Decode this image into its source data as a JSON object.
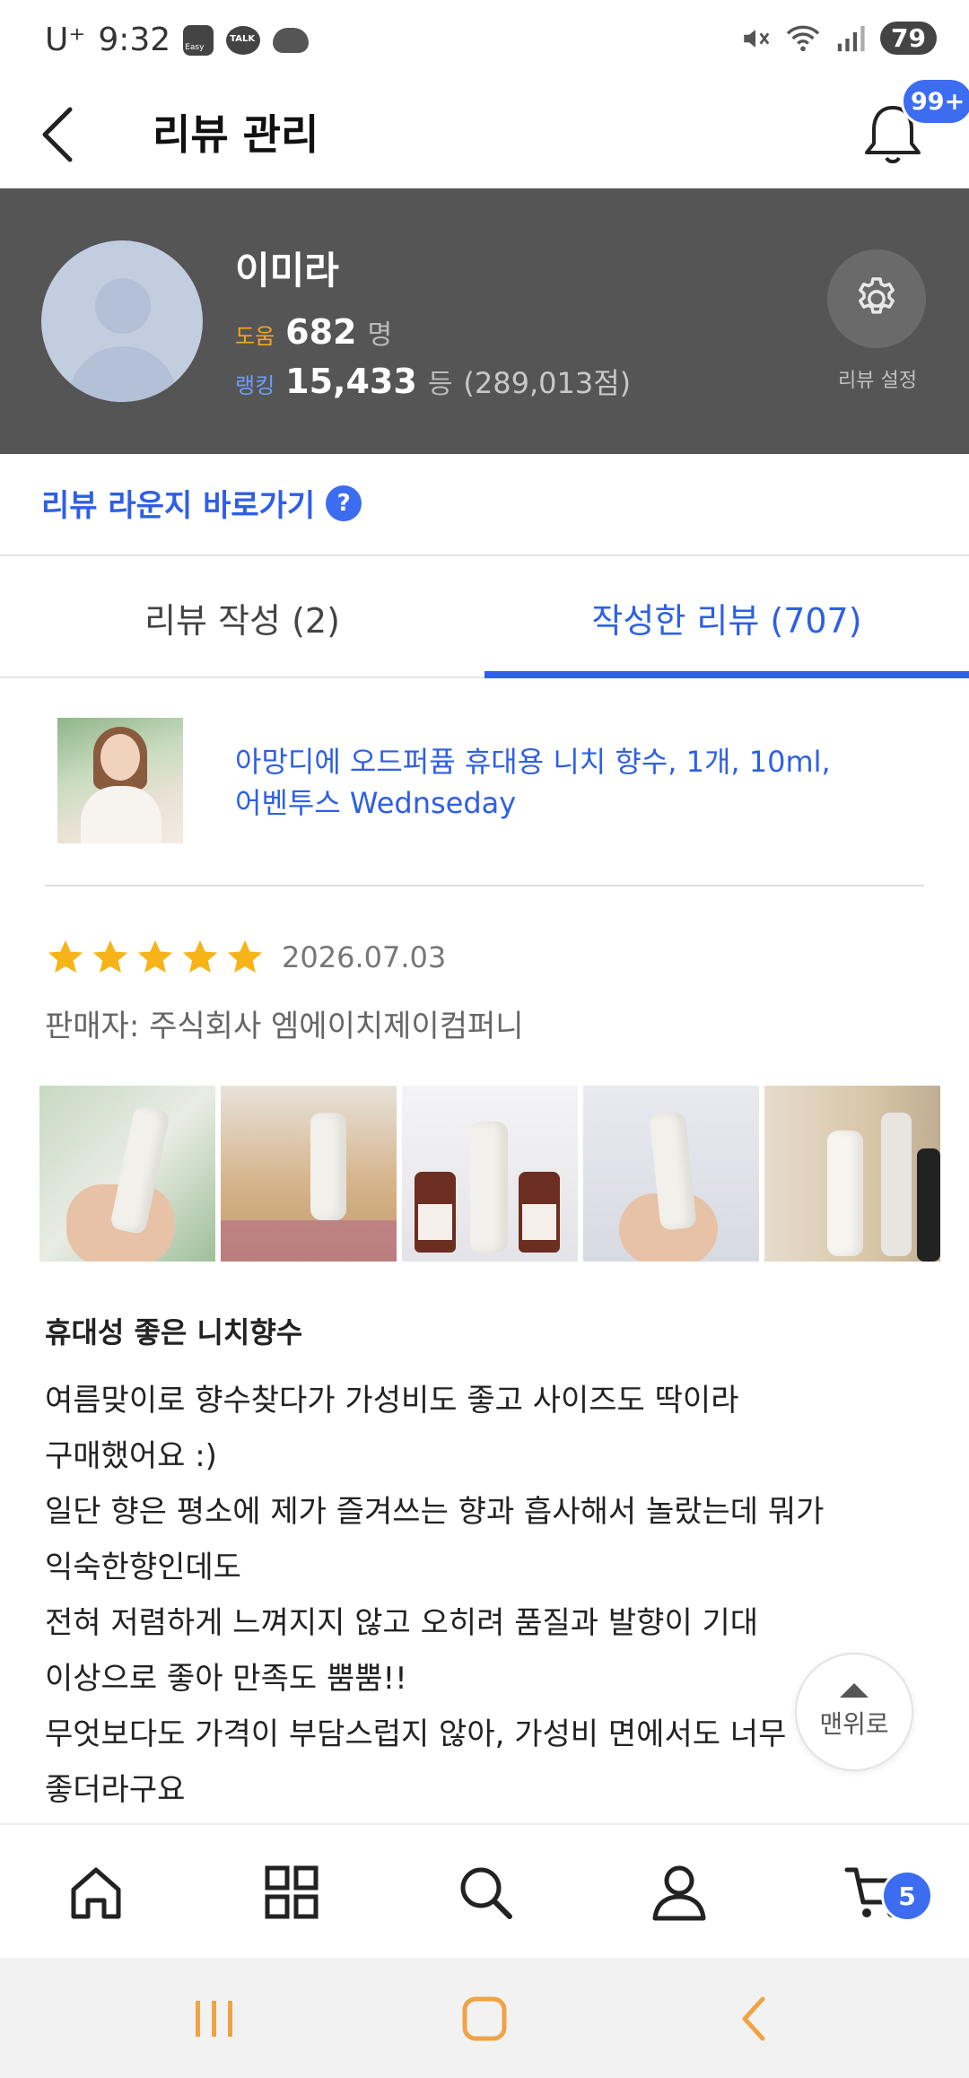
{
  "status_bar": {
    "carrier": "U⁺",
    "time": "9:32",
    "icon_easy": "Easy",
    "icon_talk": "TALK",
    "battery": "79"
  },
  "header": {
    "title": "리뷰 관리",
    "notification_count": "99+"
  },
  "profile": {
    "name": "이미라",
    "help_label": "도움",
    "help_value": "682",
    "help_unit": "명",
    "rank_label": "랭킹",
    "rank_value": "15,433",
    "rank_unit": "등",
    "rank_points": "(289,013점)",
    "settings_label": "리뷰 설정"
  },
  "lounge": {
    "label": "리뷰 라운지 바로가기",
    "help_symbol": "?"
  },
  "tabs": [
    {
      "label": "리뷰 작성 (2)",
      "active": false
    },
    {
      "label": "작성한 리뷰 (707)",
      "active": true
    }
  ],
  "product": {
    "name_line1": "아망디에 오드퍼퓸 휴대용 니치 향수, 1개, 10ml,",
    "name_line2": "어벤투스 Wednseday"
  },
  "review": {
    "rating": 5,
    "date": "2026.07.03",
    "seller": "판매자: 주식회사 엠에이치제이컴퍼니",
    "photo_count": 5,
    "title": "휴대성 좋은 니치향수",
    "body_lines": [
      "여름맞이로 향수찾다가 가성비도 좋고 사이즈도 딱이라",
      "구매했어요 :)",
      "일단 향은 평소에 제가 즐겨쓰는 향과 흡사해서 놀랐는데 뭐가",
      "익숙한향인데도",
      "전혀 저렴하게 느껴지지 않고 오히려 품질과 발향이 기대",
      "이상으로 좋아 만족도 뿜뿜!!",
      "무엇보다도 가격이 부담스럽지 않아, 가성비 면에서도 너무",
      "좋더라구요"
    ]
  },
  "scroll_top": {
    "label": "맨위로"
  },
  "bottom_nav": {
    "items": [
      "home-icon",
      "category-icon",
      "search-icon",
      "user-icon",
      "cart-icon"
    ],
    "cart_count": "5"
  },
  "colors": {
    "accent_blue": "#2e5fe6",
    "badge_blue": "#3c6cf0",
    "profile_bg": "#555555",
    "star_yellow": "#f6b419",
    "help_orange": "#f5a623",
    "system_nav_orange": "#f0a346"
  }
}
